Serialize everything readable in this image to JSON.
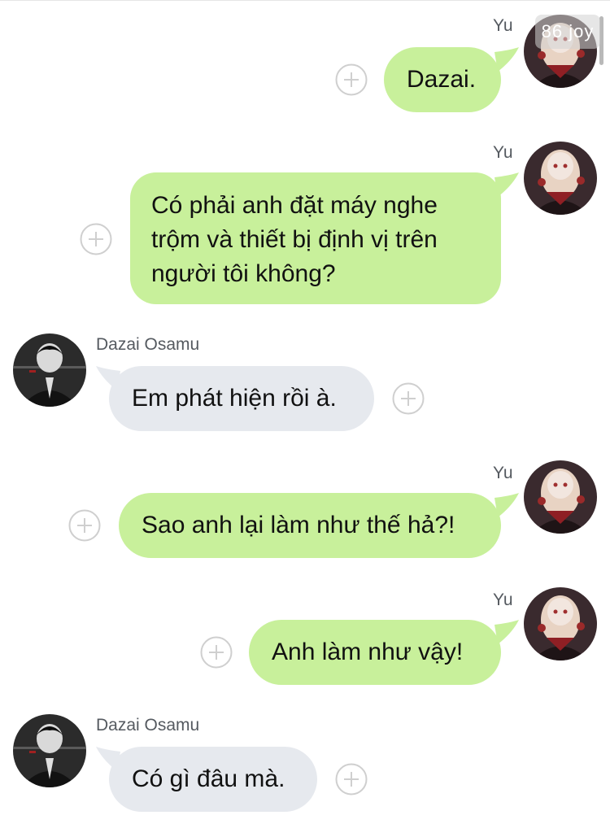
{
  "watermark": "86 joy",
  "colors": {
    "outgoing_bubble": "#c8f09b",
    "incoming_bubble": "#e6e9ee"
  },
  "icons": {
    "add": "plus-circle-icon"
  },
  "messages": [
    {
      "sender": "Yu",
      "text": "Dazai.",
      "direction": "outgoing"
    },
    {
      "sender": "Yu",
      "lines": [
        "Có phải anh đặt máy nghe",
        "trộm và thiết bị định vị trên",
        "người tôi không?"
      ],
      "direction": "outgoing"
    },
    {
      "sender": "Dazai Osamu",
      "text": "Em phát hiện rồi à.",
      "direction": "incoming"
    },
    {
      "sender": "Yu",
      "text": "Sao anh lại làm như thế hả?!",
      "direction": "outgoing"
    },
    {
      "sender": "Yu",
      "text": "Anh làm như vậy!",
      "direction": "outgoing"
    },
    {
      "sender": "Dazai Osamu",
      "text": "Có gì đâu mà.",
      "direction": "incoming"
    }
  ]
}
